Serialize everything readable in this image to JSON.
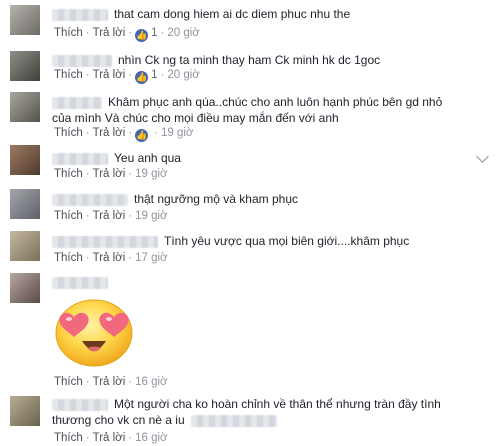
{
  "actions": {
    "like": "Thích",
    "reply": "Trả lời"
  },
  "comments": [
    {
      "text": "that cam dong hiem ai dc diem phuc nhu the",
      "likes": "1",
      "time": "20 giờ"
    },
    {
      "text": "nhìn Ck ng ta minh thay ham Ck minh hk dc 1goc",
      "likes": "1",
      "time": "20 giờ"
    },
    {
      "text": "Khâm phục anh qúa..chúc cho anh luôn hạnh phúc bên gd nhỏ",
      "text2": "của mình Và chúc cho mọi điều may mắn đến với anh",
      "time": "19 giờ"
    },
    {
      "text": "Yeu anh qua",
      "time": "19 giờ"
    },
    {
      "text": "thật ngưỡng mộ và kham phục",
      "time": "19 giờ"
    },
    {
      "text": "Tình yêu vược qua mọi biên giới....khâm phục",
      "time": "17 giờ"
    },
    {
      "sticker": "heart-eyes-emoji",
      "time": "16 giờ"
    },
    {
      "text": "Một người cha ko hoàn chỉnh về thân thể nhưng tràn đầy tình",
      "text2": "thương cho vk cn nè a iu",
      "time": "16 giờ"
    }
  ],
  "icons": {
    "like_badge": "thumbs-up-icon",
    "menu": "chevron-down-icon"
  },
  "colors": {
    "link": "#4b4f56",
    "time": "#90949c",
    "badge": "#4267b2"
  }
}
